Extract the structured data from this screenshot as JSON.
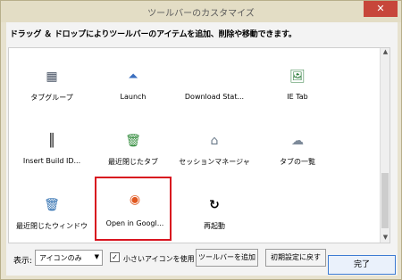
{
  "window": {
    "title": "ツールバーのカスタマイズ",
    "close_icon": "close-icon"
  },
  "instruction": "ドラッグ ＆ ドロップによりツールバーのアイテムを追加、削除や移動できます。",
  "items": [
    {
      "label": "タブグループ",
      "icon": "tab-group-icon",
      "glyph": "▦"
    },
    {
      "label": "Launch",
      "icon": "launch-icon",
      "glyph": "⏶"
    },
    {
      "label": "Download Stat...",
      "icon": "download-stat-icon",
      "glyph": ""
    },
    {
      "label": "IE Tab",
      "icon": "ie-tab-icon",
      "glyph": "🖼"
    },
    {
      "label": "Insert Build ID...",
      "icon": "barcode-icon",
      "glyph": "║"
    },
    {
      "label": "最近閉じたタブ",
      "icon": "recent-tab-icon",
      "glyph": "🗑"
    },
    {
      "label": "セッションマネージャ",
      "icon": "session-manager-icon",
      "glyph": "⌂"
    },
    {
      "label": "タブの一覧",
      "icon": "tab-list-icon",
      "glyph": "☁"
    },
    {
      "label": "最近閉じたウィンドウ",
      "icon": "recent-window-icon",
      "glyph": "🗑"
    },
    {
      "label": "Open in Googl...",
      "icon": "chrome-icon",
      "glyph": "◉",
      "selected": true
    },
    {
      "label": "再起動",
      "icon": "restart-icon",
      "glyph": "↻"
    }
  ],
  "bottom": {
    "show_label": "表示:",
    "select_value": "アイコンのみ",
    "checkbox_checked": true,
    "small_icons_label": "小さいアイコンを使用",
    "add_toolbar_label": "ツールバーを追加",
    "reset_label": "初期設定に戻す"
  },
  "footer": {
    "done_label": "完了"
  },
  "colors": {
    "selection_border": "#d8141f",
    "titlebar": "#e3ddc5",
    "close_button": "#c7463a"
  }
}
